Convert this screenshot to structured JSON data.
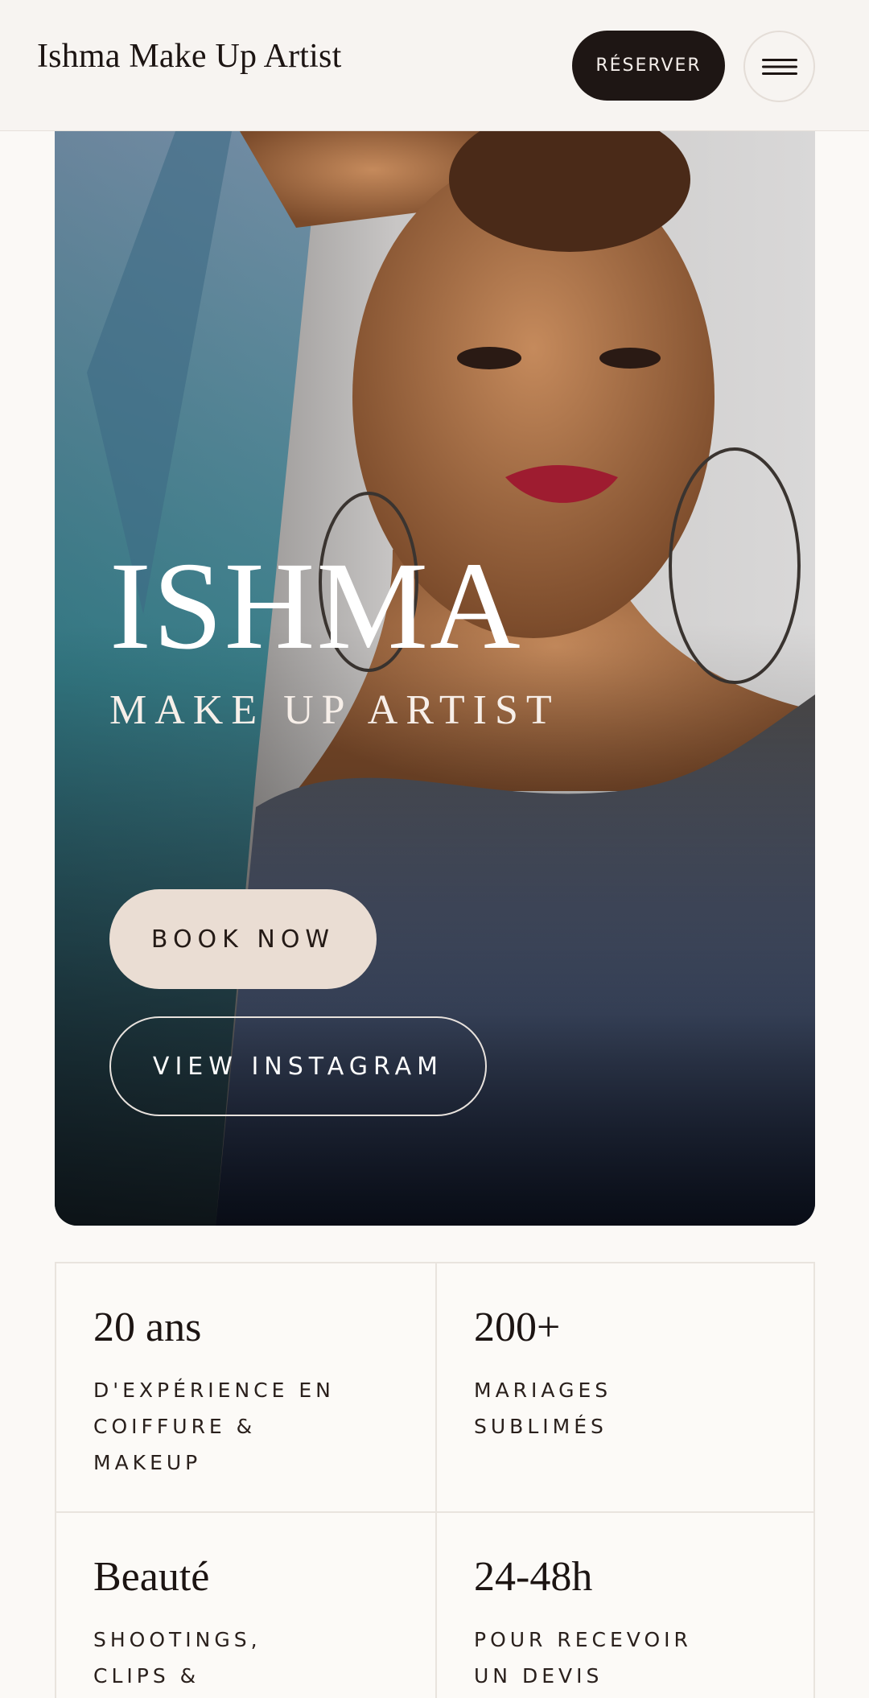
{
  "header": {
    "brand": "Ishma Make Up Artist",
    "reserve_label": "RÉSERVER",
    "menu_icon": "hamburger-icon"
  },
  "hero": {
    "title": "ISHMA",
    "subtitle": "MAKE UP ARTIST",
    "book_label": "BOOK NOW",
    "instagram_label": "VIEW INSTAGRAM",
    "image_description": "hero-portrait"
  },
  "stats": [
    {
      "value": "20 ans",
      "label": "D'EXPÉRIENCE EN COIFFURE & MAKEUP"
    },
    {
      "value": "200+",
      "label": "MARIAGES SUBLIMÉS"
    },
    {
      "value": "Beauté",
      "label": "SHOOTINGS, CLIPS & ÉDITORIAL"
    },
    {
      "value": "24-48h",
      "label": "POUR RECEVOIR UN DEVIS"
    }
  ],
  "colors": {
    "accent_dark": "#1e1614",
    "book_button": "#eaddd3",
    "background": "#fbf9f6"
  }
}
